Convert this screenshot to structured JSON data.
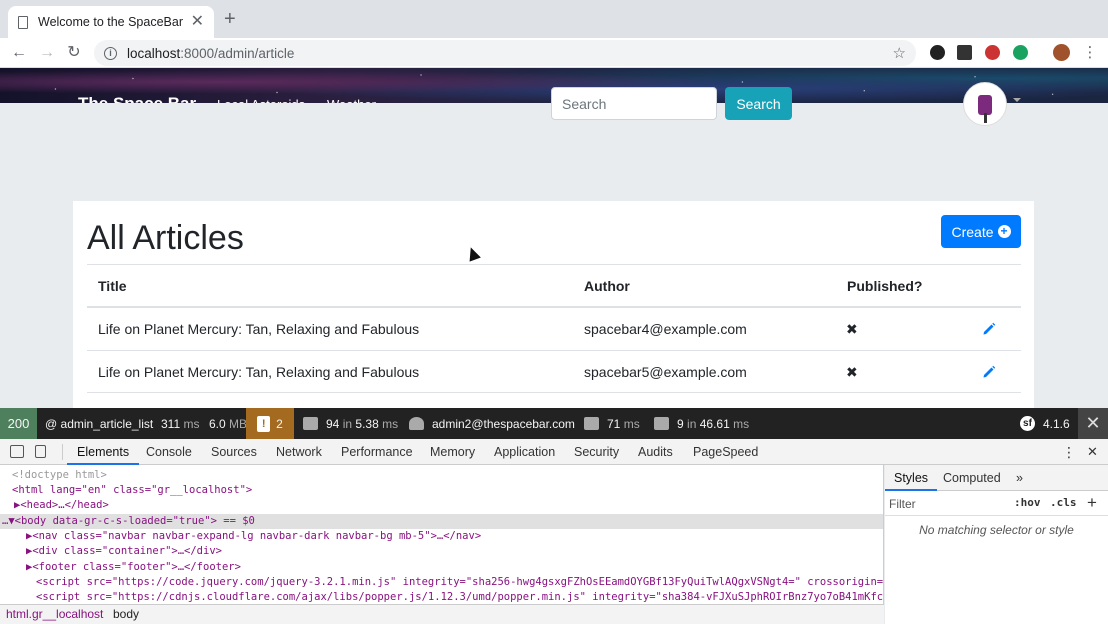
{
  "browser": {
    "tab_title": "Welcome to the SpaceBar",
    "tab_close": "✕",
    "new_tab": "+",
    "url_host": "localhost",
    "url_path": ":8000/admin/article",
    "back": "←",
    "forward": "→",
    "reload": "↻",
    "star": "☆"
  },
  "site_nav": {
    "brand": "The Space Bar",
    "links": [
      "Local Asteroids",
      "Weather"
    ],
    "search_placeholder": "Search",
    "search_button": "Search"
  },
  "page": {
    "title": "All Articles",
    "create_button": "Create",
    "columns": [
      "Title",
      "Author",
      "Published?"
    ],
    "rows": [
      {
        "title": "Life on Planet Mercury: Tan, Relaxing and Fabulous",
        "author": "spacebar4@example.com",
        "published": "✖"
      },
      {
        "title": "Life on Planet Mercury: Tan, Relaxing and Fabulous",
        "author": "spacebar5@example.com",
        "published": "✖"
      }
    ]
  },
  "profiler": {
    "status": "200",
    "route": "@ admin_article_list",
    "time": "311",
    "time_unit": "ms",
    "memory": "6.0",
    "memory_unit": "MB",
    "warnings": "2",
    "twig_count": "94",
    "twig_in": "in",
    "twig_time": "5.38",
    "twig_unit": "ms",
    "user": "admin2@thespacebar.com",
    "forms_time": "71",
    "forms_unit": "ms",
    "db_count": "9",
    "db_in": "in",
    "db_time": "46.61",
    "db_unit": "ms",
    "version": "4.1.6",
    "close": "✕"
  },
  "devtools": {
    "tabs": [
      "Elements",
      "Console",
      "Sources",
      "Network",
      "Performance",
      "Memory",
      "Application",
      "Security",
      "Audits",
      "PageSpeed"
    ],
    "more": "⋮",
    "close": "✕",
    "styles_tabs": [
      "Styles",
      "Computed",
      "»"
    ],
    "filter_placeholder": "Filter",
    "hov": ":hov",
    "cls": ".cls",
    "plus": "+",
    "no_match": "No matching selector or style",
    "breadcrumbs": [
      "html.gr__localhost",
      "body"
    ],
    "dom_lines": [
      "<!doctype html>",
      "<html lang=\"en\" class=\"gr__localhost\">",
      "▶<head>…</head>",
      "…▼<body data-gr-c-s-loaded=\"true\"> == $0",
      "▶<nav class=\"navbar navbar-expand-lg navbar-dark navbar-bg mb-5\">…</nav>",
      "▶<div class=\"container\">…</div>",
      "▶<footer class=\"footer\">…</footer>",
      "<script src=\"https://code.jquery.com/jquery-3.2.1.min.js\" integrity=\"sha256-hwg4gsxgFZhOsEEamdOYGBf13FyQuiTwlAQgxVSNgt4=\" crossorigin=\"",
      "<script src=\"https://cdnjs.cloudflare.com/ajax/libs/popper.js/1.12.3/umd/popper.min.js\" integrity=\"sha384-vFJXuSJphROIrBnz7yo7oB41mKfc8"
    ]
  }
}
